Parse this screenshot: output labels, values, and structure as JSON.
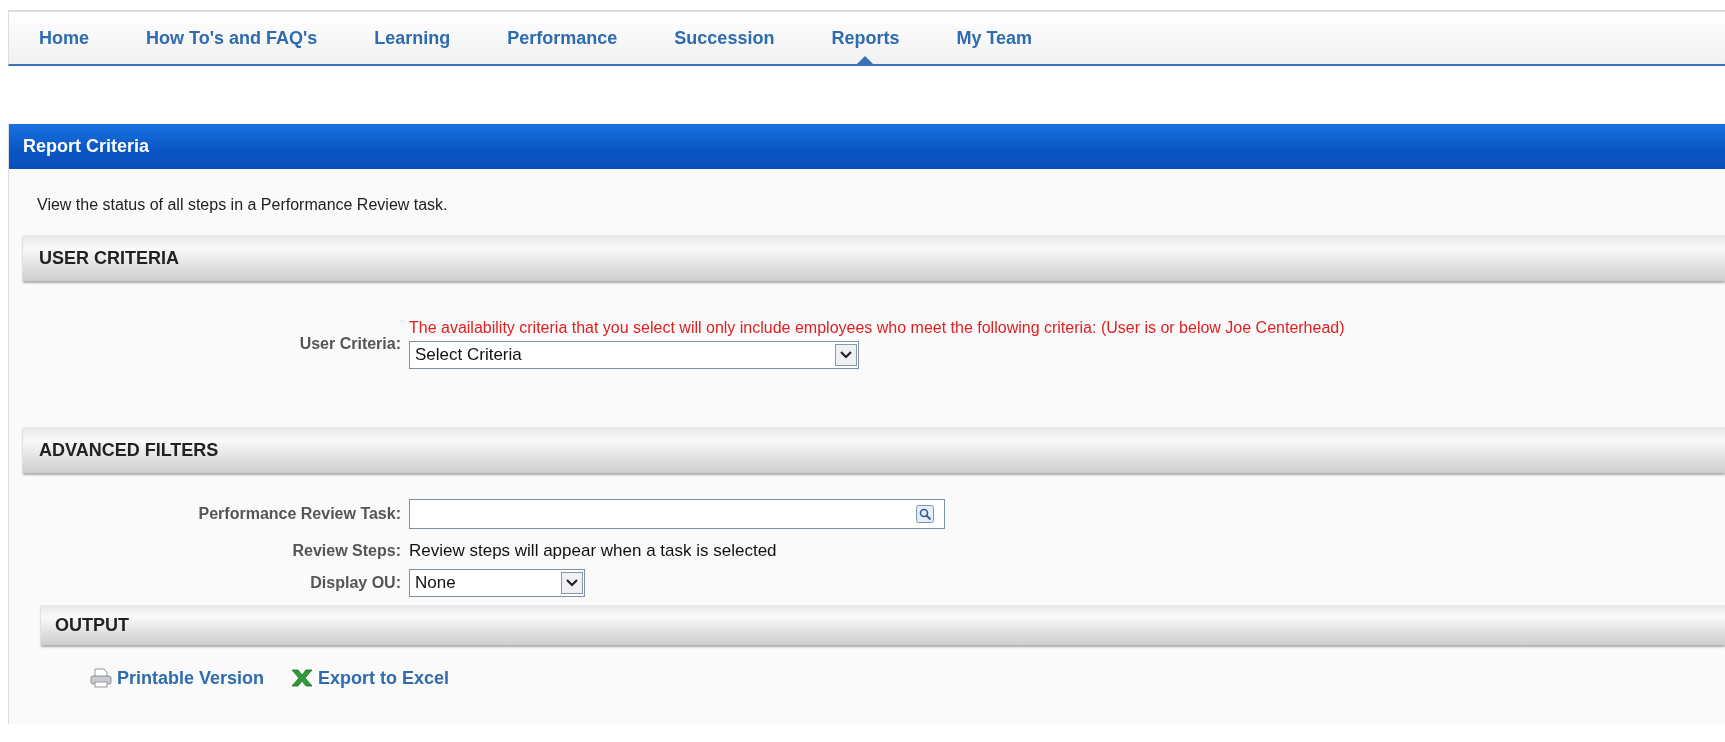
{
  "nav": {
    "tabs": [
      {
        "label": "Home",
        "selected": false
      },
      {
        "label": "How To's and FAQ's",
        "selected": false
      },
      {
        "label": "Learning",
        "selected": false
      },
      {
        "label": "Performance",
        "selected": false
      },
      {
        "label": "Succession",
        "selected": false
      },
      {
        "label": "Reports",
        "selected": true
      },
      {
        "label": "My Team",
        "selected": false
      }
    ]
  },
  "panel": {
    "title": "Report Criteria",
    "description": "View the status of all steps in a Performance Review task."
  },
  "sections": [
    {
      "title": "USER CRITERIA",
      "rows": [
        {
          "kind": "wide_select",
          "label": "User Criteria:",
          "notice": "The availability criteria that you select will only include employees who meet the following criteria: (User is or below Joe Centerhead)",
          "value": "Select Criteria"
        }
      ]
    },
    {
      "title": "ADVANCED FILTERS",
      "rows": [
        {
          "kind": "lookup",
          "label": "Performance Review Task:"
        },
        {
          "kind": "text",
          "label": "Review Steps:",
          "text": "Review steps will appear when a task is selected"
        },
        {
          "kind": "select",
          "label": "Display OU:",
          "value": "None"
        }
      ]
    },
    {
      "title": "OUTPUT",
      "links": [
        {
          "kind": "printer",
          "label": "Printable Version"
        },
        {
          "kind": "excel",
          "label": "Export to Excel"
        }
      ]
    }
  ]
}
